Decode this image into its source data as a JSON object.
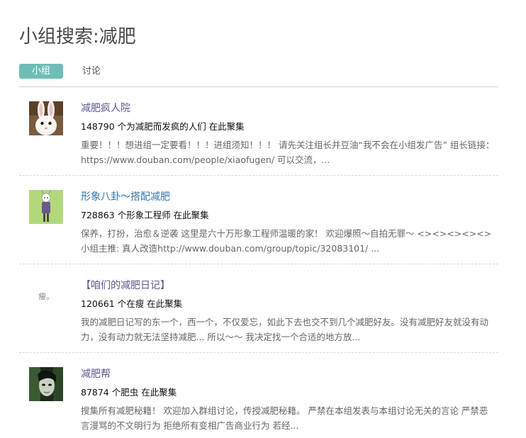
{
  "page": {
    "title": "小组搜索:减肥"
  },
  "tabs": [
    {
      "label": "小组",
      "active": true
    },
    {
      "label": "讨论",
      "active": false
    }
  ],
  "colors": {
    "tab_active_bg": "#6fbdb8",
    "link": "#3377aa",
    "link_visited": "#5a5a92",
    "text": "#111111",
    "muted": "#666666"
  },
  "results": [
    {
      "title": "减肥疯人院",
      "count": "148790 个为减肥而发疯的人们 在此聚集",
      "desc": "重要！！！想进组一定要看！！！进组须知！！！ 请先关注组长并豆油“我不会在小组发广告” 组长链接：https://www.douban.com/people/xiaofugen/ 可以交流，...",
      "avatar": "white-rabbit"
    },
    {
      "title": "形象八卦～搭配减肥",
      "count": "728863 个形象工程师 在此聚集",
      "desc": "保养，打扮，治愈＆逆袭 这里是六十万形象工程师温暖的家！ 欢迎爆照～自拍无罪～ <><><><><>小组主推: 真人改造http://www.douban.com/group/topic/32083101/ ...",
      "avatar": "cartoon-figure"
    },
    {
      "title": "【咱们的减肥日记】",
      "count": "120661 个在瘦 在此聚集",
      "desc": "我的减肥日记写的东一个，西一个，不仅爱忘，如此下去也交不到几个减肥好友。没有减肥好友就没有动力，没有动力就无法坚持减肥... 所以～～ 我决定找一个合适的地方放...",
      "avatar": "text-logo",
      "avatar_text": "瘦。"
    },
    {
      "title": "减肥帮",
      "count": "87874 个肥虫 在此聚集",
      "desc": "搜集所有减肥秘籍！ 欢迎加入群组讨论，传授减肥秘籍。 严禁在本组发表与本组讨论无关的言论 严禁恶言漫骂的不文明行为 拒绝所有变相广告商业行为 若经...",
      "avatar": "dark-face"
    }
  ]
}
